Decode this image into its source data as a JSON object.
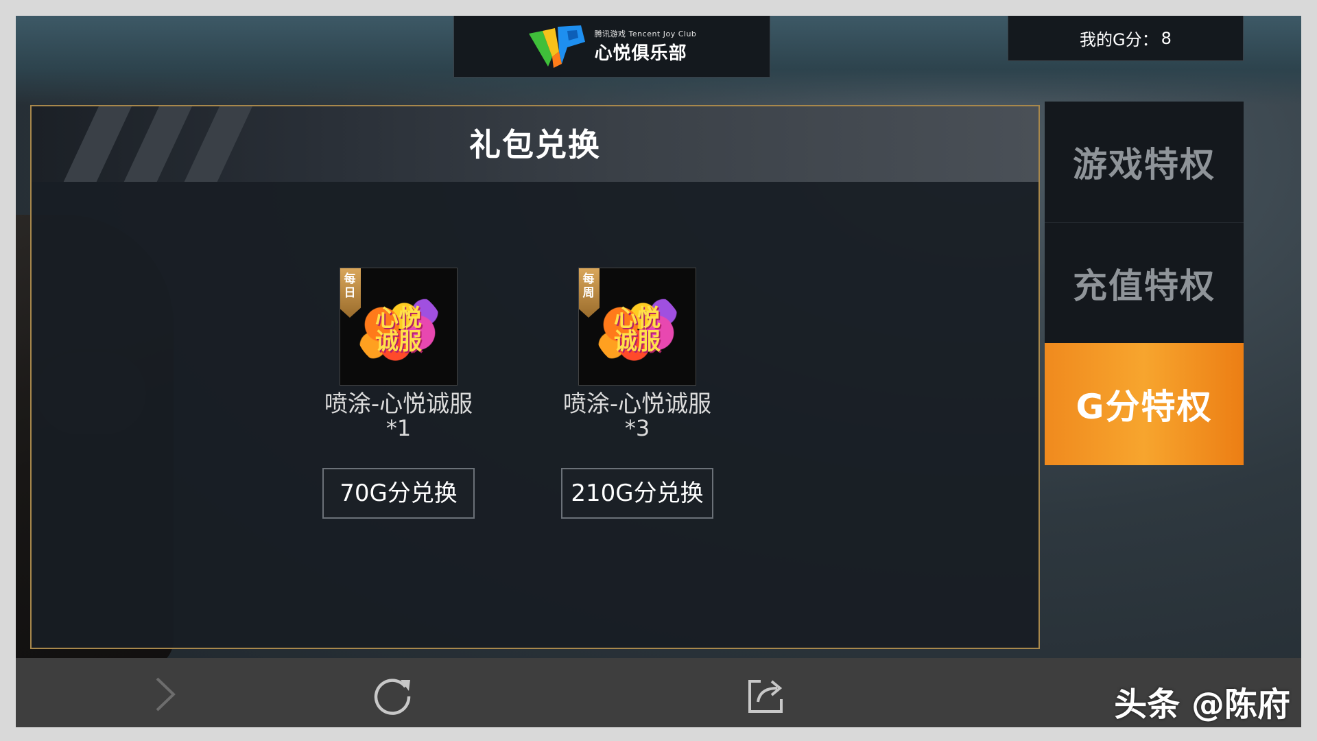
{
  "header": {
    "logo_subtitle": "腾讯游戏 Tencent Joy Club",
    "logo_title": "心悦俱乐部",
    "gscore_label": "我的G分：",
    "gscore_value": "8"
  },
  "panel": {
    "title": "礼包兑换",
    "gifts": [
      {
        "badge": "每\n日",
        "icon_text": "心悦\n诚服",
        "name": "喷涂-心悦诚服",
        "qty": "*1",
        "button_label": "70G分兑换"
      },
      {
        "badge": "每\n周",
        "icon_text": "心悦\n诚服",
        "name": "喷涂-心悦诚服",
        "qty": "*3",
        "button_label": "210G分兑换"
      }
    ]
  },
  "sidebar": {
    "items": [
      {
        "label": "游戏特权",
        "active": false
      },
      {
        "label": "充值特权",
        "active": false
      },
      {
        "label": "G分特权",
        "active": true
      }
    ],
    "active_color": "#f28c1f"
  },
  "bottom_bar": {
    "icons": [
      "forward-arrow-icon",
      "refresh-icon",
      "share-icon"
    ],
    "watermark": "头条 @陈府"
  },
  "colors": {
    "panel_border": "#a8884c",
    "accent_orange": "#f28c1f"
  }
}
